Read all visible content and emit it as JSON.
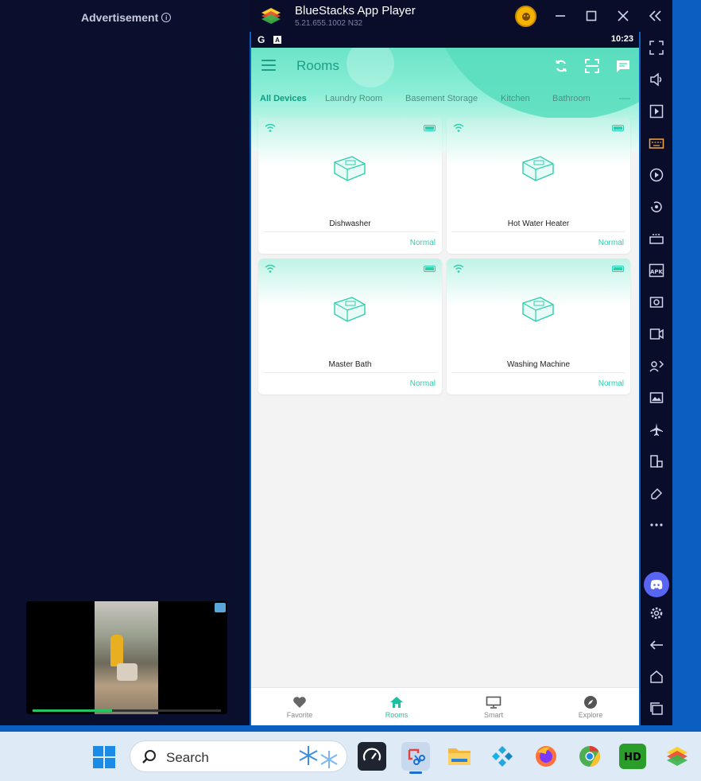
{
  "ad": {
    "label": "Advertisement",
    "info_icon": "info-icon",
    "progress_fraction": 0.42
  },
  "window": {
    "title": "BlueStacks App Player",
    "version": "5.21.655.1002  N32",
    "controls": [
      "minimize-icon",
      "maximize-icon",
      "close-icon",
      "collapse-panel-icon"
    ]
  },
  "status_bar": {
    "left_glyph": "G",
    "badge": "A",
    "time": "10:23"
  },
  "app": {
    "title": "Rooms",
    "header_icons": [
      "sync-icon",
      "scan-icon",
      "message-icon"
    ],
    "tabs": [
      {
        "label": "All Devices",
        "active": true
      },
      {
        "label": "Laundry Room",
        "active": false
      },
      {
        "label": "Basement Storage",
        "active": false
      },
      {
        "label": "Kitchen",
        "active": false
      },
      {
        "label": "Bathroom",
        "active": false
      }
    ],
    "devices": [
      {
        "name": "Dishwasher",
        "status": "Normal"
      },
      {
        "name": "Hot Water Heater",
        "status": "Normal"
      },
      {
        "name": "Master Bath",
        "status": "Normal"
      },
      {
        "name": "Washing Machine",
        "status": "Normal"
      }
    ],
    "bottom_nav": [
      {
        "label": "Favorite",
        "icon": "heart-icon",
        "active": false
      },
      {
        "label": "Rooms",
        "icon": "home-icon",
        "active": true
      },
      {
        "label": "Smart",
        "icon": "monitor-icon",
        "active": false
      },
      {
        "label": "Explore",
        "icon": "compass-icon",
        "active": false
      }
    ],
    "accent_color": "#1dbf9e"
  },
  "sidebar_icons": [
    "fullscreen-icon",
    "volume-icon",
    "media-icon",
    "keyboard-icon",
    "macro-icon",
    "rotate-icon",
    "game-controls-icon",
    "apk-install-icon",
    "screenshot-icon",
    "record-icon",
    "eco-mode-icon",
    "media-folder-icon",
    "airplane-icon",
    "multi-instance-icon",
    "erase-icon",
    "more-icon",
    "discord-icon",
    "settings-icon",
    "back-icon",
    "home-icon",
    "recent-apps-icon"
  ],
  "taskbar": {
    "search_label": "Search",
    "apps": [
      "start-icon",
      "speedtest-icon",
      "snipping-tool-icon",
      "file-explorer-icon",
      "kodi-icon",
      "firefox-icon",
      "chrome-icon",
      "hd-app-icon",
      "bluestacks-icon"
    ]
  }
}
